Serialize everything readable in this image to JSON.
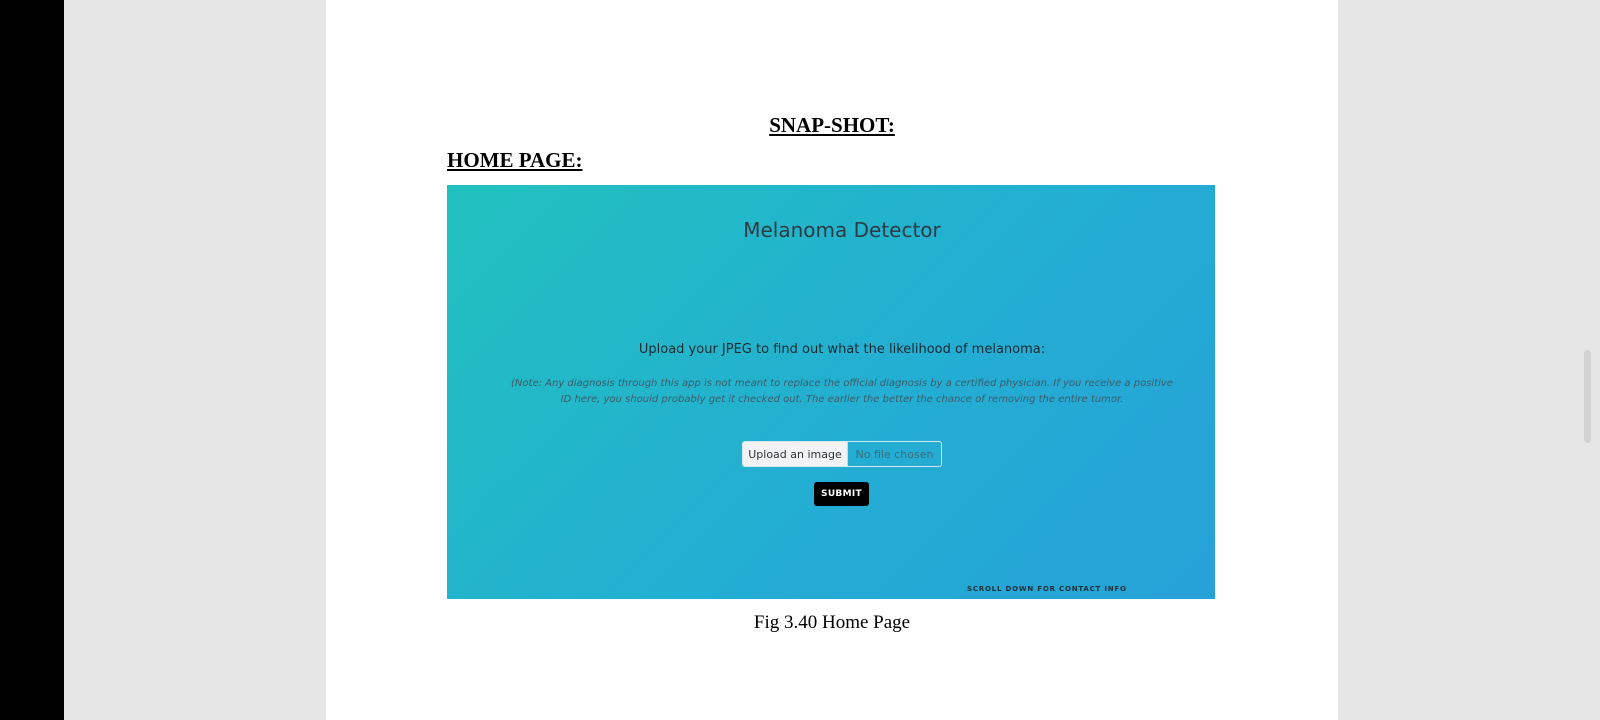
{
  "document": {
    "section_heading": "SNAP-SHOT:",
    "subheading": "HOME PAGE:",
    "caption": "Fig 3.40 Home Page"
  },
  "app": {
    "title": "Melanoma Detector",
    "upload_prompt": "Upload your JPEG to find out what the likelihood of melanoma:",
    "note": "(Note: Any diagnosis through this app is not meant to replace the official diagnosis by a certified physician. If you receive a positive ID here, you should probably get it checked out. The earlier the better the chance of removing the entire tumor.",
    "file_button_label": "Upload an image",
    "file_status": "No file chosen",
    "submit_label": "SUBMIT",
    "scroll_hint": "SCROLL DOWN FOR CONTACT INFO"
  },
  "colors": {
    "gradient_start": "#22c1be",
    "gradient_end": "#26a1d8",
    "submit_bg": "#000000"
  }
}
